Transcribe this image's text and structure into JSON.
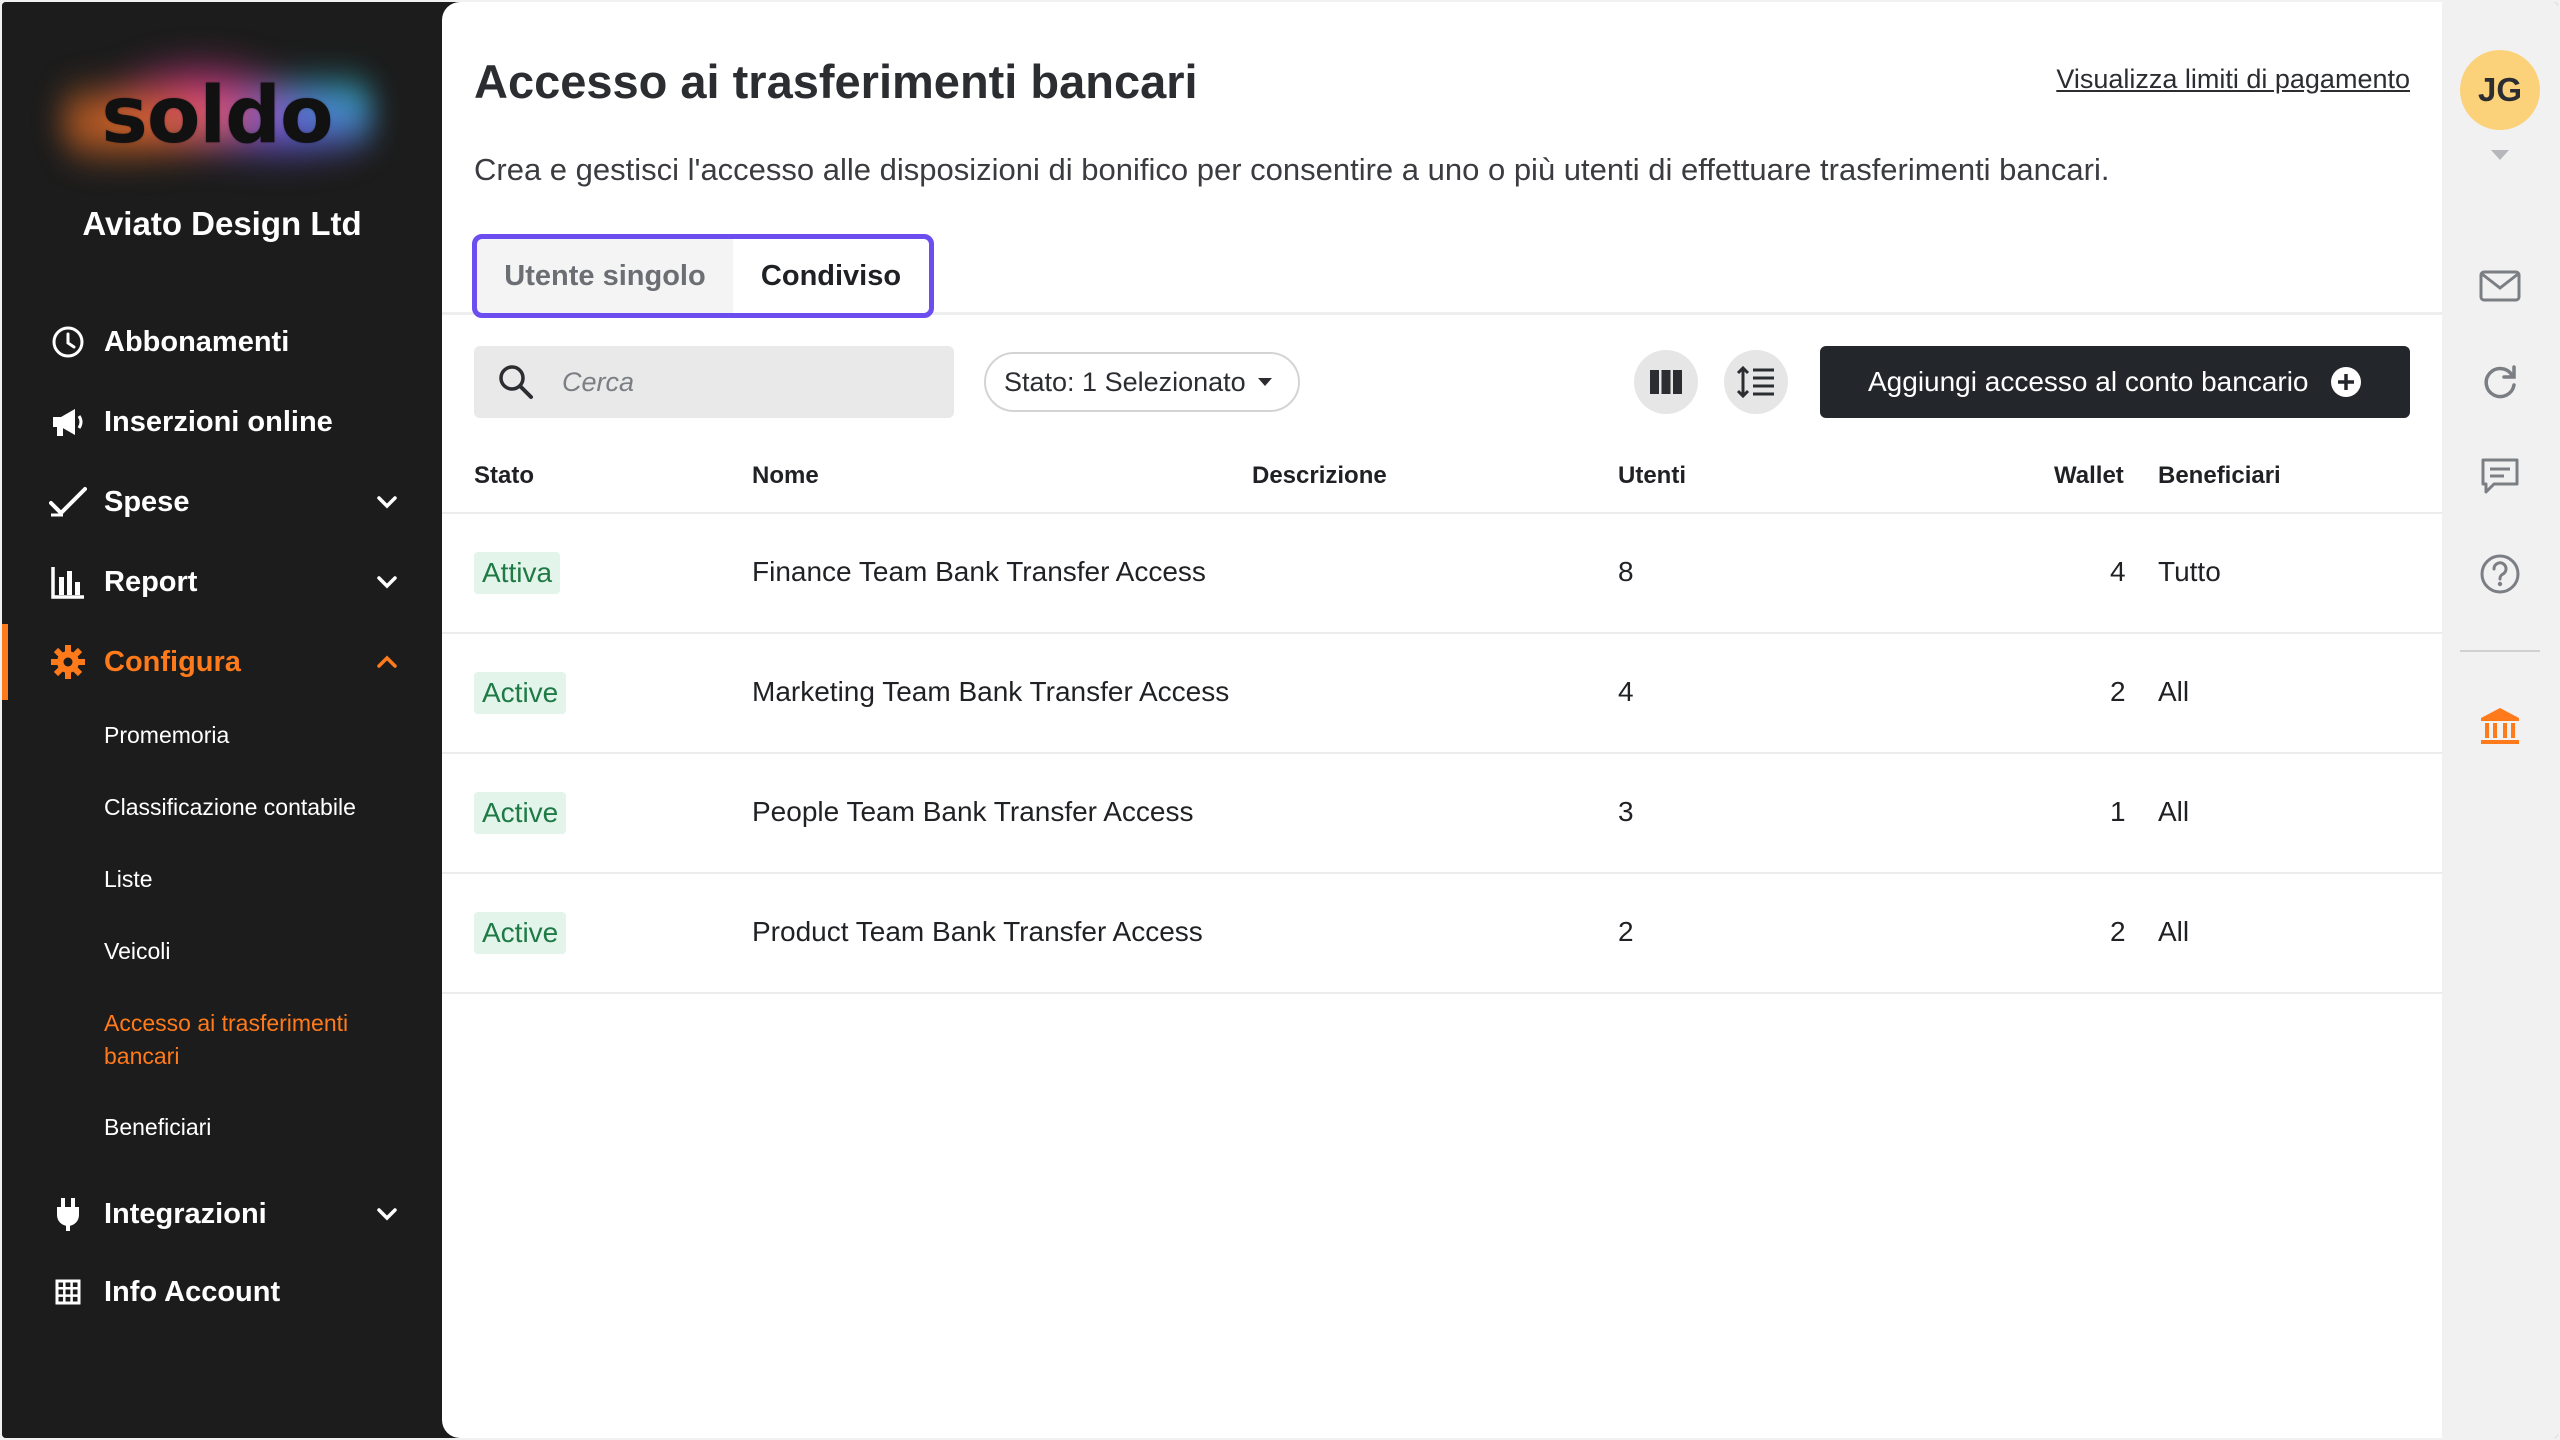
{
  "sidebar": {
    "logo": "soldo",
    "company": "Aviato Design Ltd",
    "nav": [
      {
        "label": "Abbonamenti",
        "icon": "clock-icon"
      },
      {
        "label": "Inserzioni online",
        "icon": "megaphone-icon"
      },
      {
        "label": "Spese",
        "icon": "checkmark-icon"
      },
      {
        "label": "Report",
        "icon": "bar-chart-icon"
      },
      {
        "label": "Configura",
        "icon": "gear-icon"
      },
      {
        "label": "Integrazioni",
        "icon": "plug-icon"
      },
      {
        "label": "Info Account",
        "icon": "grid-icon"
      }
    ],
    "sub": [
      {
        "label": "Promemoria"
      },
      {
        "label": "Classificazione contabile"
      },
      {
        "label": "Liste"
      },
      {
        "label": "Veicoli"
      },
      {
        "label": "Accesso ai trasferimenti bancari"
      },
      {
        "label": "Beneficiari"
      }
    ],
    "accent": "#ff7a1a"
  },
  "main": {
    "title": "Accesso ai trasferimenti bancari",
    "limits_link": "Visualizza limiti di pagamento",
    "subtitle": "Crea e gestisci l'accesso alle disposizioni di bonifico per consentire a uno o più utenti di effettuare trasferimenti bancari.",
    "tabs": [
      {
        "label": "Utente singolo",
        "selected": false
      },
      {
        "label": "Condiviso",
        "selected": true
      }
    ],
    "search_placeholder": "Cerca",
    "filter_label": "Stato: 1 Selezionato",
    "add_button": "Aggiungi accesso al conto bancario",
    "columns": [
      "Stato",
      "Nome",
      "Descrizione",
      "Utenti",
      "Wallet",
      "Beneficiari"
    ],
    "rows": [
      {
        "status": "Attiva",
        "name": "Finance Team Bank Transfer Access",
        "description": "",
        "users": "8",
        "wallet": "4",
        "beneficiaries": "Tutto"
      },
      {
        "status": "Active",
        "name": "Marketing Team Bank Transfer Access",
        "description": "",
        "users": "4",
        "wallet": "2",
        "beneficiaries": "All"
      },
      {
        "status": "Active",
        "name": "People Team Bank Transfer Access",
        "description": "",
        "users": "3",
        "wallet": "1",
        "beneficiaries": "All"
      },
      {
        "status": "Active",
        "name": "Product Team Bank Transfer Access",
        "description": "",
        "users": "2",
        "wallet": "2",
        "beneficiaries": "All"
      }
    ]
  },
  "rail": {
    "avatar_initials": "JG",
    "icons": [
      "mail-icon",
      "refresh-icon",
      "chat-icon",
      "help-icon",
      "bank-icon"
    ],
    "tab_outline_color": "#6b4df0"
  }
}
